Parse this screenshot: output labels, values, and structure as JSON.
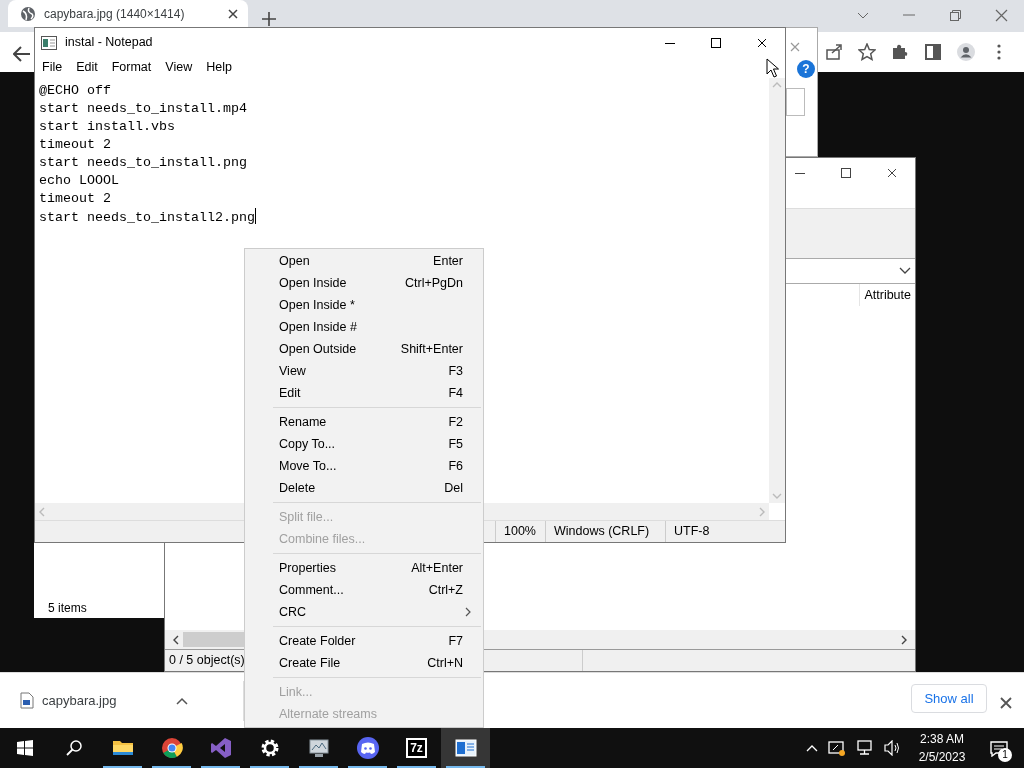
{
  "browser": {
    "tab": {
      "title": "capybara.jpg (1440×1414)",
      "selected": true
    }
  },
  "download_bar": {
    "file": "capybara.jpg",
    "button": "Show all"
  },
  "folder_window": {
    "status": "5 items"
  },
  "archive_window": {
    "column": "Attribute",
    "status": "0 / 5 object(s)"
  },
  "dialog": {
    "help": "?"
  },
  "notepad": {
    "title": "instal - Notepad",
    "menu": [
      "File",
      "Edit",
      "Format",
      "View",
      "Help"
    ],
    "lines": [
      "@ECHO off",
      "start needs_to_install.mp4",
      "start install.vbs",
      "timeout 2",
      "start needs_to_install.png",
      "echo LOOOL",
      "timeout 2",
      "start needs_to_install2.png"
    ],
    "status": [
      "100%",
      "Windows (CRLF)",
      "UTF-8"
    ]
  },
  "context_menu": {
    "groups": [
      {
        "items": [
          {
            "label": "Open",
            "shortcut": "Enter",
            "disabled": false,
            "kind": "item"
          },
          {
            "label": "Open Inside",
            "shortcut": "Ctrl+PgDn",
            "disabled": false,
            "kind": "item"
          },
          {
            "label": "Open Inside *",
            "disabled": false,
            "kind": "item"
          },
          {
            "label": "Open Inside #",
            "disabled": false,
            "kind": "item"
          },
          {
            "label": "Open Outside",
            "shortcut": "Shift+Enter",
            "disabled": false,
            "kind": "item"
          },
          {
            "label": "View",
            "shortcut": "F3",
            "disabled": false,
            "kind": "item"
          },
          {
            "label": "Edit",
            "shortcut": "F4",
            "disabled": false,
            "kind": "item"
          }
        ]
      },
      {
        "items": [
          {
            "label": "Rename",
            "shortcut": "F2",
            "disabled": false,
            "kind": "item"
          },
          {
            "label": "Copy To...",
            "shortcut": "F5",
            "disabled": false,
            "kind": "item"
          },
          {
            "label": "Move To...",
            "shortcut": "F6",
            "disabled": false,
            "kind": "item"
          },
          {
            "label": "Delete",
            "shortcut": "Del",
            "disabled": false,
            "kind": "item"
          }
        ]
      },
      {
        "items": [
          {
            "label": "Split file...",
            "disabled": true,
            "kind": "item"
          },
          {
            "label": "Combine files...",
            "disabled": true,
            "kind": "item"
          }
        ]
      },
      {
        "items": [
          {
            "label": "Properties",
            "shortcut": "Alt+Enter",
            "disabled": false,
            "kind": "item"
          },
          {
            "label": "Comment...",
            "shortcut": "Ctrl+Z",
            "disabled": false,
            "kind": "item"
          },
          {
            "label": "CRC",
            "disabled": false,
            "kind": "submenu"
          }
        ]
      },
      {
        "items": [
          {
            "label": "Create Folder",
            "shortcut": "F7",
            "disabled": false,
            "kind": "item"
          },
          {
            "label": "Create File",
            "shortcut": "Ctrl+N",
            "disabled": false,
            "kind": "item"
          }
        ]
      },
      {
        "items": [
          {
            "label": "Link...",
            "disabled": true,
            "kind": "item"
          },
          {
            "label": "Alternate streams",
            "disabled": true,
            "kind": "item"
          }
        ]
      }
    ]
  },
  "taskbar": {
    "apps": [
      {
        "kind": "folder",
        "running": true,
        "active": false
      },
      {
        "kind": "browser",
        "running": true,
        "active": false
      },
      {
        "kind": "studio",
        "running": true,
        "active": false
      },
      {
        "kind": "gear",
        "running": true,
        "active": false
      },
      {
        "kind": "monitor",
        "running": true,
        "active": false
      },
      {
        "kind": "chat",
        "running": true,
        "active": false
      },
      {
        "kind": "archiver",
        "label": "7z",
        "running": true,
        "active": false
      },
      {
        "kind": "notepad",
        "running": true,
        "active": true
      }
    ],
    "time": "2:38 AM",
    "date": "2/5/2023",
    "notifications": "1"
  }
}
